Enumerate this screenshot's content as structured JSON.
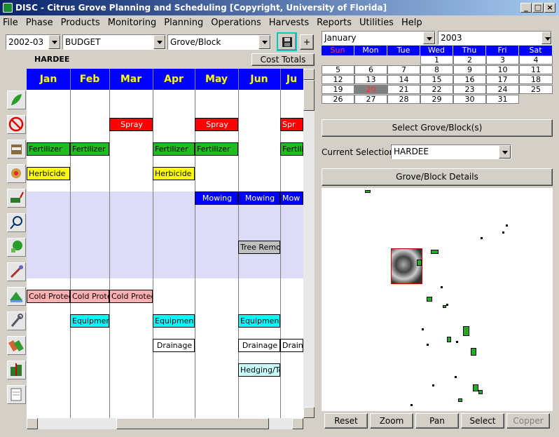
{
  "window": {
    "title": "DISC - Citrus Grove Planning and Scheduling [Copyright, University of Florida]"
  },
  "menu": [
    "File",
    "Phase",
    "Products",
    "Monitoring",
    "Planning",
    "Operations",
    "Harvests",
    "Reports",
    "Utilities",
    "Help"
  ],
  "toolbar": {
    "season": "2002-03",
    "plan": "BUDGET",
    "scope": "Grove/Block",
    "add_label": "+"
  },
  "grid": {
    "location": "HARDEE",
    "cost_totals_label": "Cost Totals",
    "months": [
      "Jan",
      "Feb",
      "Mar",
      "Apr",
      "May",
      "Jun",
      "Ju"
    ],
    "tasks": {
      "spray": [
        "Spray",
        "Spray",
        "Spr"
      ],
      "fertilizer": [
        "Fertilizer",
        "Fertilizer",
        "Fertilizer",
        "Fertilizer",
        "Fertili"
      ],
      "herbicide": [
        "Herbicide",
        "Herbicide"
      ],
      "mowing": [
        "Mowing",
        "Mowing",
        "Mow"
      ],
      "tree_removal": [
        "Tree Remov"
      ],
      "cold_protection": [
        "Cold Protecti",
        "Cold Prote",
        "Cold Protecti"
      ],
      "equipment": [
        "Equipment",
        "Equipment",
        "Equipment"
      ],
      "drainage": [
        "Drainage",
        "Drainage",
        "Drain"
      ],
      "hedging": [
        "Hedging/To"
      ]
    }
  },
  "calendar": {
    "month": "January",
    "year": "2003",
    "weekdays": [
      "Sun",
      "Mon",
      "Tue",
      "Wed",
      "Thu",
      "Fri",
      "Sat"
    ],
    "weeks": [
      [
        "",
        "",
        "",
        "1",
        "2",
        "3",
        "4"
      ],
      [
        "5",
        "6",
        "7",
        "8",
        "9",
        "10",
        "11"
      ],
      [
        "12",
        "13",
        "14",
        "15",
        "16",
        "17",
        "18"
      ],
      [
        "19",
        "20",
        "21",
        "22",
        "23",
        "24",
        "25"
      ],
      [
        "26",
        "27",
        "28",
        "29",
        "30",
        "31",
        ""
      ]
    ],
    "today": "20"
  },
  "right_panel": {
    "select_blocks_label": "Select Grove/Block(s)",
    "current_selection_label": "Current Selection:",
    "current_selection_value": "HARDEE",
    "details_label": "Grove/Block Details"
  },
  "map_buttons": [
    "Reset",
    "Zoom",
    "Pan",
    "Select",
    "Copper"
  ],
  "colors": {
    "month_header": "#0000ff",
    "month_text": "#ffff00",
    "spray": "#ff0000",
    "fertilizer": "#22bb22",
    "herbicide": "#ffff00",
    "mowing": "#0000ff",
    "cold_protection": "#ffb0b0",
    "equipment": "#00ffff",
    "hedging": "#c8ffff",
    "tree_removal": "#c0c0c0",
    "selection_highlight": "#00c8c8"
  },
  "icons": [
    "leaf-icon",
    "no-spray-icon",
    "fertilizer-bag-icon",
    "herbicide-weed-icon",
    "mowing-icon",
    "irrigation-icon",
    "tree-removal-icon",
    "sprayer-wand-icon",
    "cold-protection-icon",
    "equipment-wrench-icon",
    "drainage-icon",
    "hedging-icon",
    "notes-icon"
  ]
}
